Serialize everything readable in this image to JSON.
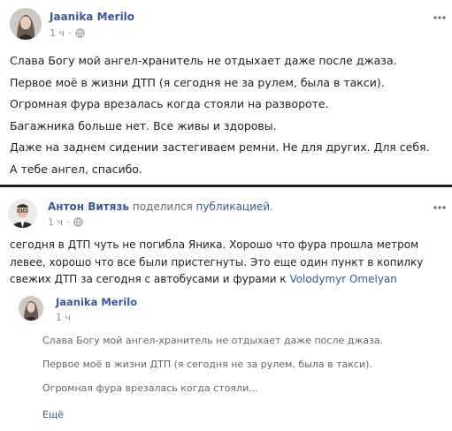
{
  "post1": {
    "author": "Jaanika Merilo",
    "time": "1 ч",
    "lines": [
      "Слава Богу мой ангел-хранитель не отдыхает даже после джаза.",
      "Первое моё в жизни ДТП (я сегодня не за рулем, была в такси).",
      "Огромная фура врезалась когда стояли на развороте.",
      "Багажника больше нет. Все живы и здоровы.",
      "Даже на заднем сидении застегиваем ремни. Не для других. Для себя.",
      "А тебе ангел, спасибо."
    ]
  },
  "post2": {
    "author": "Антон Витязь",
    "shared_text": "поделился",
    "shared_link": "публикацией",
    "period": ".",
    "time": "1 ч",
    "body_text": "сегодня в ДТП чуть не погибла Яника. Хорошо что фура прошла метром левее, хорошо что все были пристегнуты. Это еще один пункт в копилку свежих ДТП за сегодня с автобусами и фурами к ",
    "tag": "Volodymyr Omelyan"
  },
  "quoted": {
    "author": "Jaanika Merilo",
    "time": "1 ч",
    "lines": [
      "Слава Богу мой ангел-хранитель не отдыхает даже после джаза.",
      "Первое моё в жизни ДТП (я сегодня не за рулем, была в такси).",
      "Огромная фура врезалась когда стояли..."
    ],
    "more": "Ещё"
  },
  "colors": {
    "link": "#385898",
    "meta": "#90949c",
    "text": "#1c1e21"
  },
  "icons": {
    "globe": "globe-icon",
    "more": "more-options-icon"
  }
}
